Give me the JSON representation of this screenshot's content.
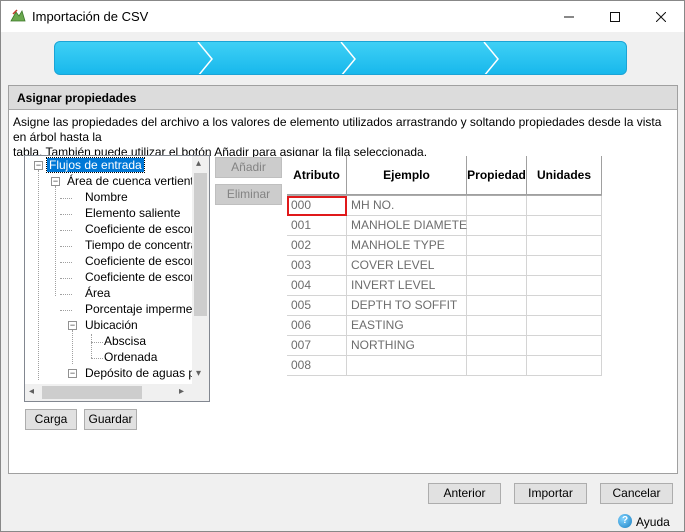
{
  "window": {
    "title": "Importación de CSV",
    "controls": {
      "minimize": "–",
      "maximize": "☐",
      "close": "✕"
    }
  },
  "wizard": {
    "steps_total": 4,
    "accent_color": "#18b8ec"
  },
  "panel": {
    "title": "Asignar propiedades",
    "instructions_line1": "Asigne las propiedades del archivo a los valores de elemento utilizados arrastrando y soltando propiedades desde la vista en árbol hasta la",
    "instructions_line2": "tabla. También puede utilizar el botón Añadir para asignar la fila seleccionada."
  },
  "tree": {
    "root": "Flujos de entrada",
    "catchment": "Área de cuenca vertiente",
    "catchment_children": [
      "Nombre",
      "Elemento saliente",
      "Coeficiente de escorre",
      "Tiempo de concentrac",
      "Coeficiente de escorre",
      "Coeficiente de escorre",
      "Área",
      "Porcentaje impermeab"
    ],
    "location": "Ubicación",
    "location_children": [
      "Abscisa",
      "Ordenada"
    ],
    "storage": "Depósito de aguas plu"
  },
  "buttons": {
    "add": "Añadir",
    "remove": "Eliminar",
    "load": "Carga",
    "save": "Guardar",
    "back": "Anterior",
    "import": "Importar",
    "cancel": "Cancelar",
    "help": "Ayuda"
  },
  "table": {
    "headers": [
      "Atributo",
      "Ejemplo",
      "Propiedad",
      "Unidades"
    ],
    "rows": [
      [
        "000",
        "MH NO.",
        "",
        ""
      ],
      [
        "001",
        "MANHOLE DIAMETER",
        "",
        ""
      ],
      [
        "002",
        "MANHOLE TYPE",
        "",
        ""
      ],
      [
        "003",
        "COVER LEVEL",
        "",
        ""
      ],
      [
        "004",
        "INVERT LEVEL",
        "",
        ""
      ],
      [
        "005",
        "DEPTH TO SOFFIT",
        "",
        ""
      ],
      [
        "006",
        "EASTING",
        "",
        ""
      ],
      [
        "007",
        "NORTHING",
        "",
        ""
      ],
      [
        "008",
        "",
        "",
        ""
      ]
    ],
    "selected_row": 0
  }
}
